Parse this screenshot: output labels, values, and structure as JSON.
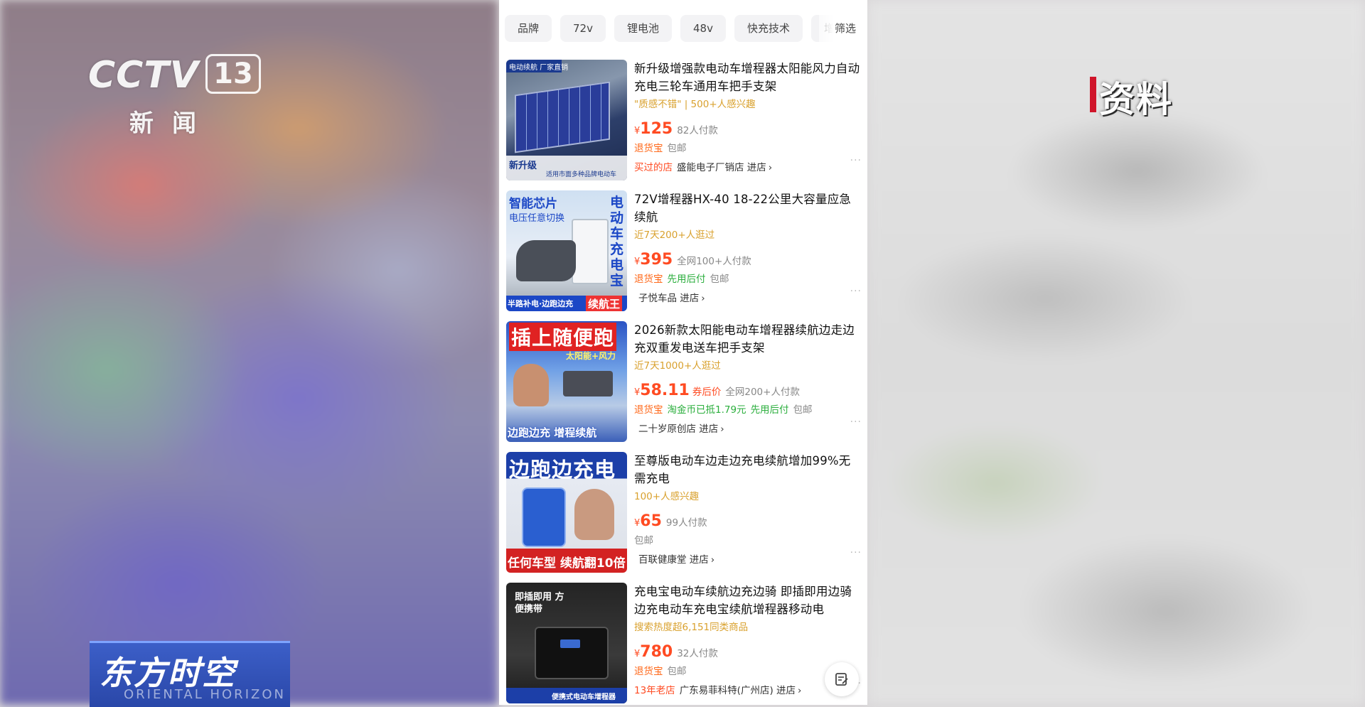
{
  "broadcast": {
    "channel_name": "CCTV",
    "channel_number": "13",
    "channel_sub": "新闻",
    "ziliao": "资料",
    "program_title": "东方时空",
    "program_sub": "ORIENTAL HORIZON"
  },
  "filters": {
    "chips": [
      "品牌",
      "72v",
      "锂电池",
      "48v",
      "快充技术",
      "增压"
    ],
    "filter_label": "筛选"
  },
  "products": [
    {
      "title": "新升级增强款电动车增程器太阳能风力自动充电三轮车通用车把手支架",
      "hint": "\"质感不错\" | 500+人感兴趣",
      "price": "125",
      "coupon": "",
      "sold": "82人付款",
      "tags": [
        {
          "text": "退货宝",
          "style": "orange"
        },
        {
          "text": "包邮",
          "style": "gray"
        }
      ],
      "shop_tag": "买过的店",
      "shop": "盛能电子厂销店",
      "enter": "进店",
      "thumb": {
        "top_label": "电动续航 厂家直销",
        "bottom_label": "新升级",
        "bottom_note": "适用市面多种品牌电动车"
      }
    },
    {
      "title": "72V增程器HX-40 18-22公里大容量应急续航",
      "hint": "近7天200+人逛过",
      "price": "395",
      "coupon": "",
      "sold": "全网100+人付款",
      "tags": [
        {
          "text": "退货宝",
          "style": "orange"
        },
        {
          "text": "先用后付",
          "style": "green"
        },
        {
          "text": "包邮",
          "style": "gray"
        }
      ],
      "shop_tag": "",
      "shop": "子悦车品",
      "enter": "进店",
      "thumb": {
        "top_label": "智能芯片",
        "sub_label": "电压任意切换",
        "side_label": "电动车充电宝",
        "bottom_label": "半路补电·边跑边充",
        "badge": "续航王"
      }
    },
    {
      "title": "2026新款太阳能电动车增程器续航边走边充双重发电送车把手支架",
      "hint": "近7天1000+人逛过",
      "price": "58.11",
      "coupon": "券后价",
      "sold": "全网200+人付款",
      "tags": [
        {
          "text": "退货宝",
          "style": "orange"
        },
        {
          "text": "淘金币已抵1.79元",
          "style": "green"
        },
        {
          "text": "先用后付",
          "style": "green"
        },
        {
          "text": "包邮",
          "style": "gray"
        }
      ],
      "shop_tag": "",
      "shop": "二十岁原创店",
      "enter": "进店",
      "thumb": {
        "top_label": "插上随便跑",
        "sub_label": "太阳能+风力",
        "bottom_label": "边跑边充 增程续航"
      }
    },
    {
      "title": "至尊版电动车边走边充电续航增加99%无需充电",
      "hint": "100+人感兴趣",
      "price": "65",
      "coupon": "",
      "sold": "99人付款",
      "tags": [
        {
          "text": "包邮",
          "style": "gray-first"
        }
      ],
      "shop_tag": "",
      "shop": "百联健康堂",
      "enter": "进店",
      "thumb": {
        "top_label": "边跑边充电",
        "bottom_label": "任何车型 续航翻10倍"
      }
    },
    {
      "title": "充电宝电动车续航边充边骑 即插即用边骑边充电动车充电宝续航增程器移动电",
      "hint": "搜索热度超6,151同类商品",
      "price": "780",
      "coupon": "",
      "sold": "32人付款",
      "tags": [
        {
          "text": "退货宝",
          "style": "orange"
        },
        {
          "text": "包邮",
          "style": "gray"
        }
      ],
      "shop_tag": "13年老店",
      "shop": "广东易菲科特(广州店)",
      "enter": "进店",
      "thumb": {
        "top_label": "即插即用 方便携带",
        "bottom_label": "便携式电动车增程器"
      }
    }
  ],
  "colors": {
    "accent": "#ff4b22",
    "hint": "#d9a12e",
    "green": "#2aae3c",
    "cctv_red": "#d0152a"
  },
  "icons": {
    "more": "more-dots-icon",
    "edit": "edit-note-icon",
    "chevron": "chevron-right-icon"
  }
}
